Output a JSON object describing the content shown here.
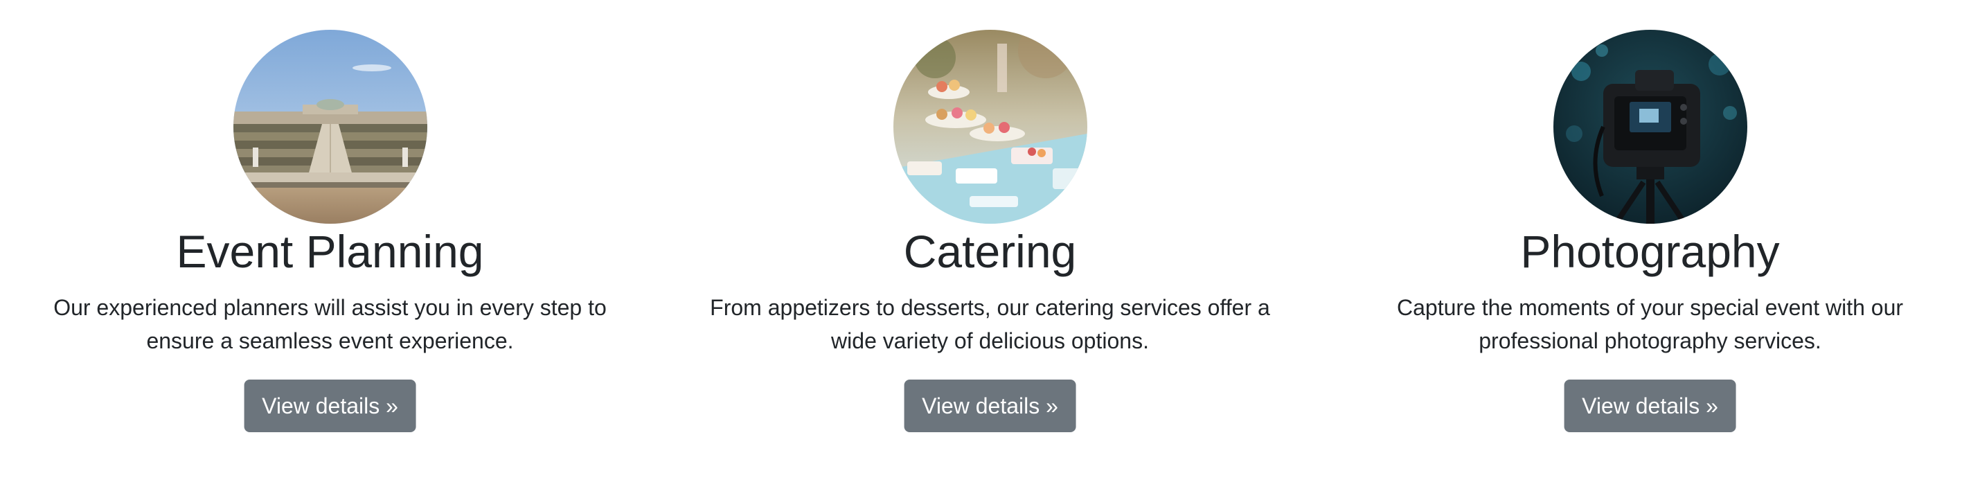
{
  "colors": {
    "text": "#212529",
    "button_bg": "#6c757d",
    "button_text": "#ffffff",
    "page_bg": "#ffffff"
  },
  "services": [
    {
      "title": "Event Planning",
      "description": "Our experienced planners will assist you in every step to ensure a seamless event experience.",
      "button_label": "View details »",
      "image": "palace-terraces-photo"
    },
    {
      "title": "Catering",
      "description": "From appetizers to desserts, our catering services offer a wide variety of delicious options.",
      "button_label": "View details »",
      "image": "dessert-buffet-photo"
    },
    {
      "title": "Photography",
      "description": "Capture the moments of your special event with our professional photography services.",
      "button_label": "View details »",
      "image": "camera-on-tripod-photo"
    }
  ]
}
